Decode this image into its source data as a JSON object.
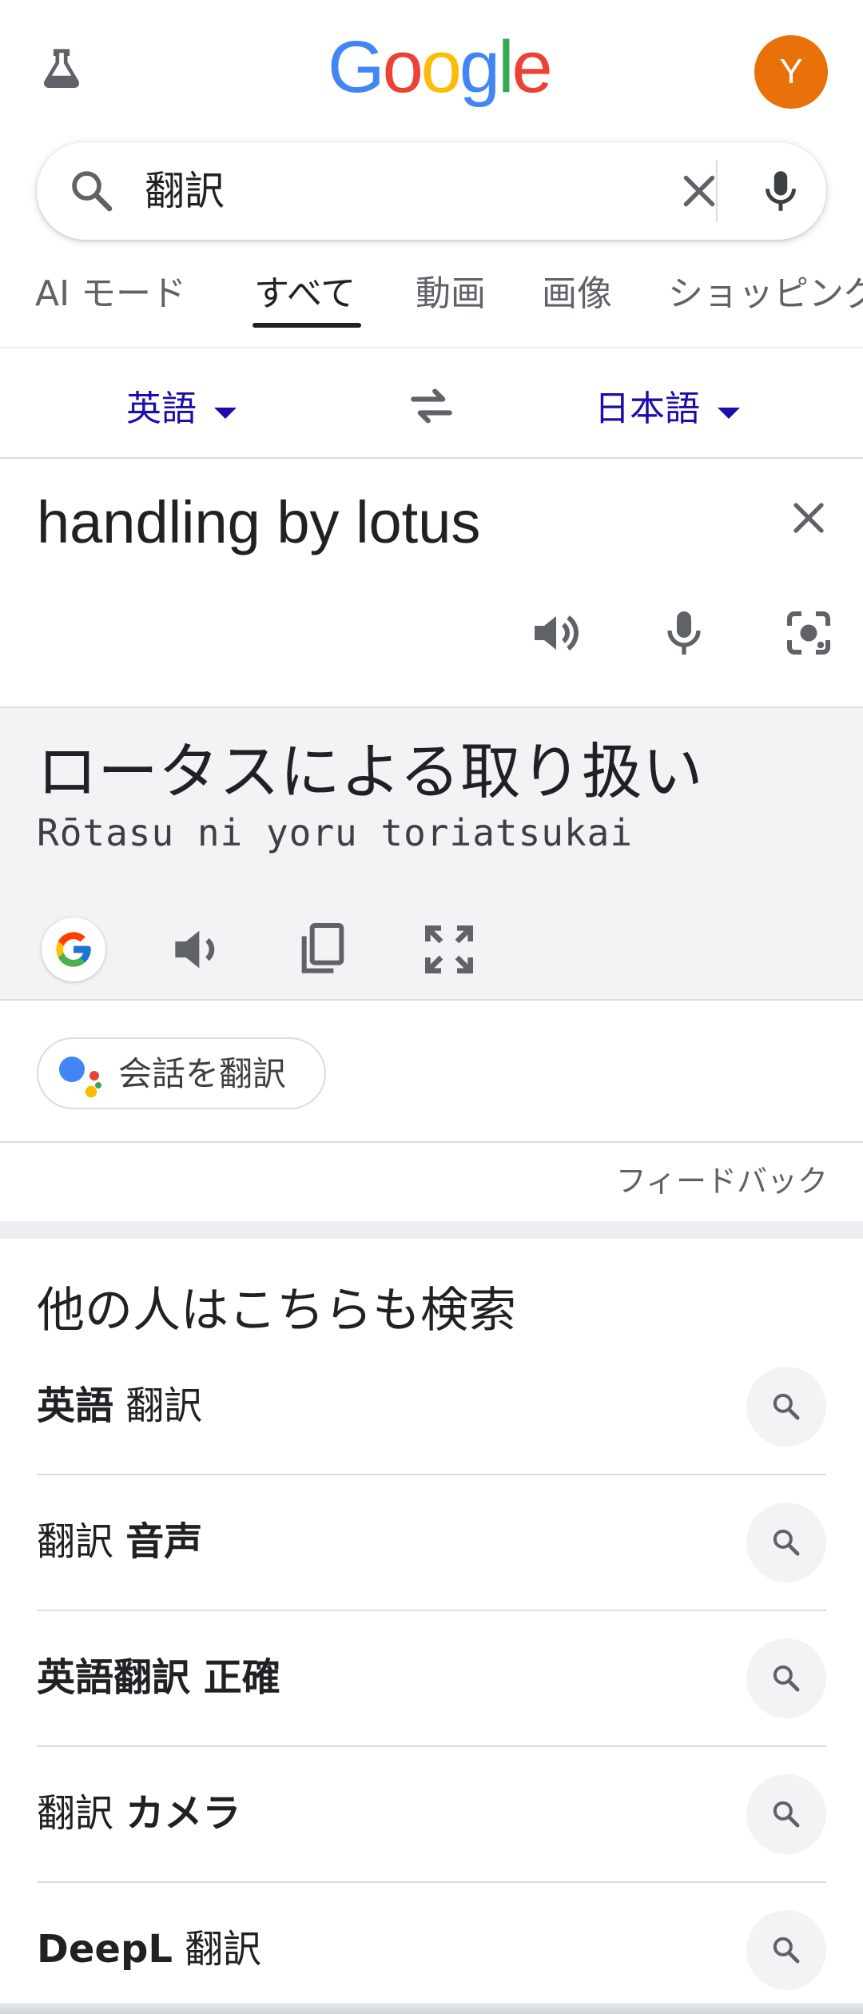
{
  "header": {
    "logo": [
      "G",
      "o",
      "o",
      "g",
      "l",
      "e"
    ],
    "logo_colors": [
      "#4285f4",
      "#ea4335",
      "#fbbc05",
      "#4285f4",
      "#34a853",
      "#ea4335"
    ],
    "avatar_letter": "Y",
    "avatar_color": "#e8710a",
    "labs_icon": "flask-icon"
  },
  "search": {
    "query": "翻訳",
    "icons": [
      "search-icon",
      "clear-icon",
      "mic-icon"
    ]
  },
  "tabs": [
    {
      "label": "AI モード",
      "active": false
    },
    {
      "label": "すべて",
      "active": true
    },
    {
      "label": "動画",
      "active": false
    },
    {
      "label": "画像",
      "active": false
    },
    {
      "label": "ショッピング",
      "active": false
    }
  ],
  "translator": {
    "source_lang": "英語",
    "target_lang": "日本語",
    "source_text": "handling by lotus",
    "translated_text": "ロータスによる取り扱い",
    "romanization": "Rōtasu ni yoru toriatsukai",
    "source_icons": [
      "close-icon",
      "speaker-icon",
      "mic-icon",
      "google-lens-icon"
    ],
    "target_icons": [
      "google-g-icon",
      "speaker-icon",
      "copy-icon",
      "fullscreen-icon"
    ],
    "conversation_button": "会話を翻訳",
    "feedback": "フィードバック"
  },
  "people_also_search": {
    "title": "他の人はこちらも検索",
    "items": [
      {
        "parts": [
          {
            "t": "英語",
            "b": true
          },
          {
            "t": " 翻訳",
            "b": false
          }
        ]
      },
      {
        "parts": [
          {
            "t": "翻訳 ",
            "b": false
          },
          {
            "t": "音声",
            "b": true
          }
        ]
      },
      {
        "parts": [
          {
            "t": "英語翻訳 正確",
            "b": true
          }
        ]
      },
      {
        "parts": [
          {
            "t": "翻訳 ",
            "b": false
          },
          {
            "t": "カメラ",
            "b": true
          }
        ]
      },
      {
        "parts": [
          {
            "t": "DeepL",
            "b": true
          },
          {
            "t": " 翻訳",
            "b": false
          }
        ]
      }
    ]
  }
}
